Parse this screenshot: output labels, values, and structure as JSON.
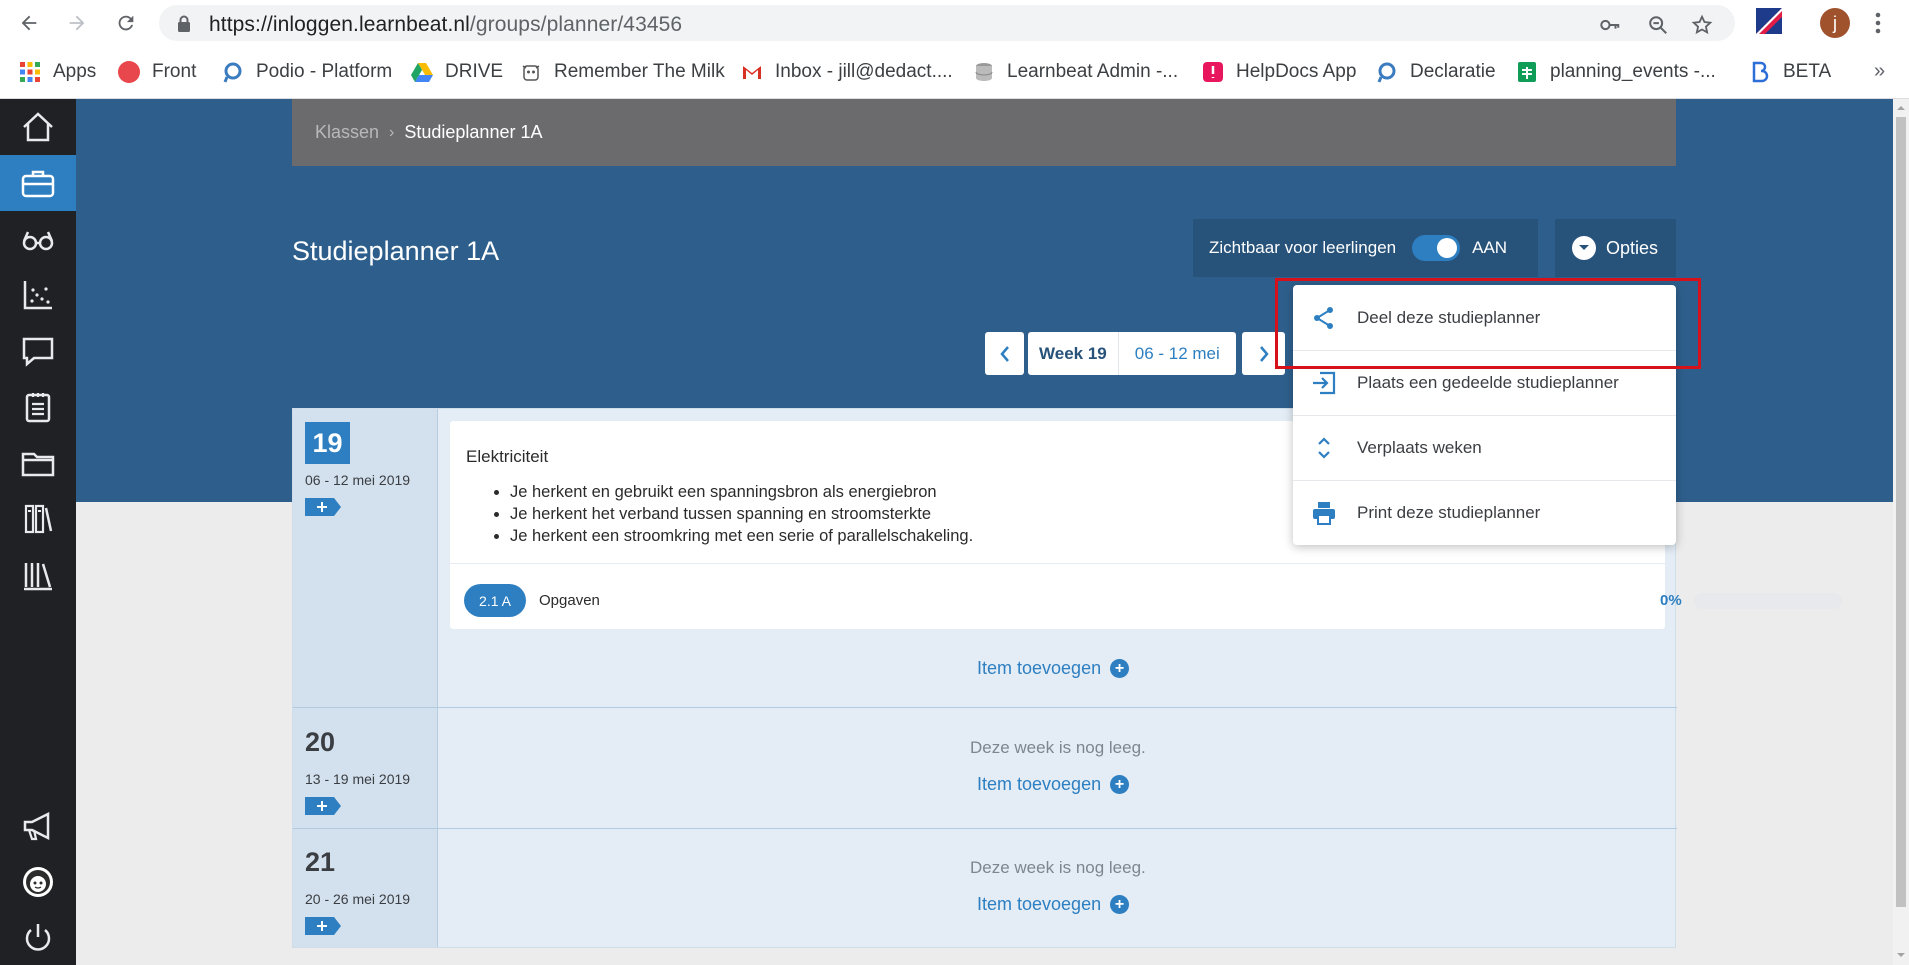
{
  "browser": {
    "url_host": "https://inloggen.learnbeat.nl",
    "url_path": "/groups/planner/43456",
    "profile_initial": "j",
    "bookmarks": [
      {
        "label": "Apps",
        "color": "#ea4335"
      },
      {
        "label": "Front",
        "color": "#e8484d"
      },
      {
        "label": "Podio - Platform",
        "color": "#3b7bbf"
      },
      {
        "label": "DRIVE",
        "color": "#1fa463"
      },
      {
        "label": "Remember The Milk",
        "color": "#555555"
      },
      {
        "label": "Inbox - jill@dedact....",
        "color": "#d93025"
      },
      {
        "label": "Learnbeat Admin -...",
        "color": "#777777"
      },
      {
        "label": "HelpDocs App",
        "color": "#e8175d"
      },
      {
        "label": "Declaratie",
        "color": "#3b7bbf"
      },
      {
        "label": "planning_events -...",
        "color": "#0f9d58"
      },
      {
        "label": "BETA",
        "color": "#2d6fd6"
      }
    ],
    "more_label": "»"
  },
  "rail": {
    "items": [
      {
        "icon": "home-icon",
        "active": false
      },
      {
        "icon": "briefcase-icon",
        "active": true
      },
      {
        "icon": "glasses-icon",
        "active": false
      },
      {
        "icon": "scatter-chart-icon",
        "active": false
      },
      {
        "icon": "chat-icon",
        "active": false
      },
      {
        "icon": "clipboard-icon",
        "active": false
      },
      {
        "icon": "folder-icon",
        "active": false
      },
      {
        "icon": "books-stack-icon",
        "active": false
      },
      {
        "icon": "library-icon",
        "active": false
      }
    ],
    "bottom_items": [
      {
        "icon": "megaphone-icon"
      },
      {
        "icon": "avatar-icon"
      },
      {
        "icon": "power-icon"
      }
    ]
  },
  "breadcrumb": {
    "parent": "Klassen",
    "current": "Studieplanner 1A"
  },
  "page": {
    "title": "Studieplanner 1A",
    "visibility_label": "Zichtbaar voor leerlingen",
    "visibility_state": "AAN",
    "visibility_on": true,
    "options_label": "Opties"
  },
  "week_nav": {
    "week_label": "Week 19",
    "range": "06 - 12 mei"
  },
  "weeks": [
    {
      "number": "19",
      "dates": "06 - 12 mei 2019",
      "current": true,
      "item": {
        "title": "Elektriciteit",
        "goals": [
          "Je herkent en gebruikt een spanningsbron als energiebron",
          "Je herkent het verband tussen spanning en stroomsterkte",
          "Je herkent een stroomkring met een serie of parallelschakeling."
        ],
        "paragraph": "2.1 A",
        "type": "Opgaven",
        "progress_label": "0%",
        "progress": 0
      },
      "add_label": "Item toevoegen"
    },
    {
      "number": "20",
      "dates": "13 - 19 mei 2019",
      "current": false,
      "empty_text": "Deze week is nog leeg.",
      "add_label": "Item toevoegen"
    },
    {
      "number": "21",
      "dates": "20 - 26 mei 2019",
      "current": false,
      "empty_text": "Deze week is nog leeg.",
      "add_label": "Item toevoegen"
    }
  ],
  "options_menu": {
    "items": [
      {
        "label": "Deel deze studieplanner",
        "icon": "share-icon"
      },
      {
        "label": "Plaats een gedeelde studieplanner",
        "icon": "import-icon"
      },
      {
        "label": "Verplaats weken",
        "icon": "move-vertical-icon"
      },
      {
        "label": "Print deze studieplanner",
        "icon": "print-icon"
      }
    ]
  },
  "colors": {
    "accent": "#2d7fc1",
    "header_bg": "#2e5f8c",
    "rail_bg": "#1f2124",
    "highlight": "#d6111a"
  }
}
